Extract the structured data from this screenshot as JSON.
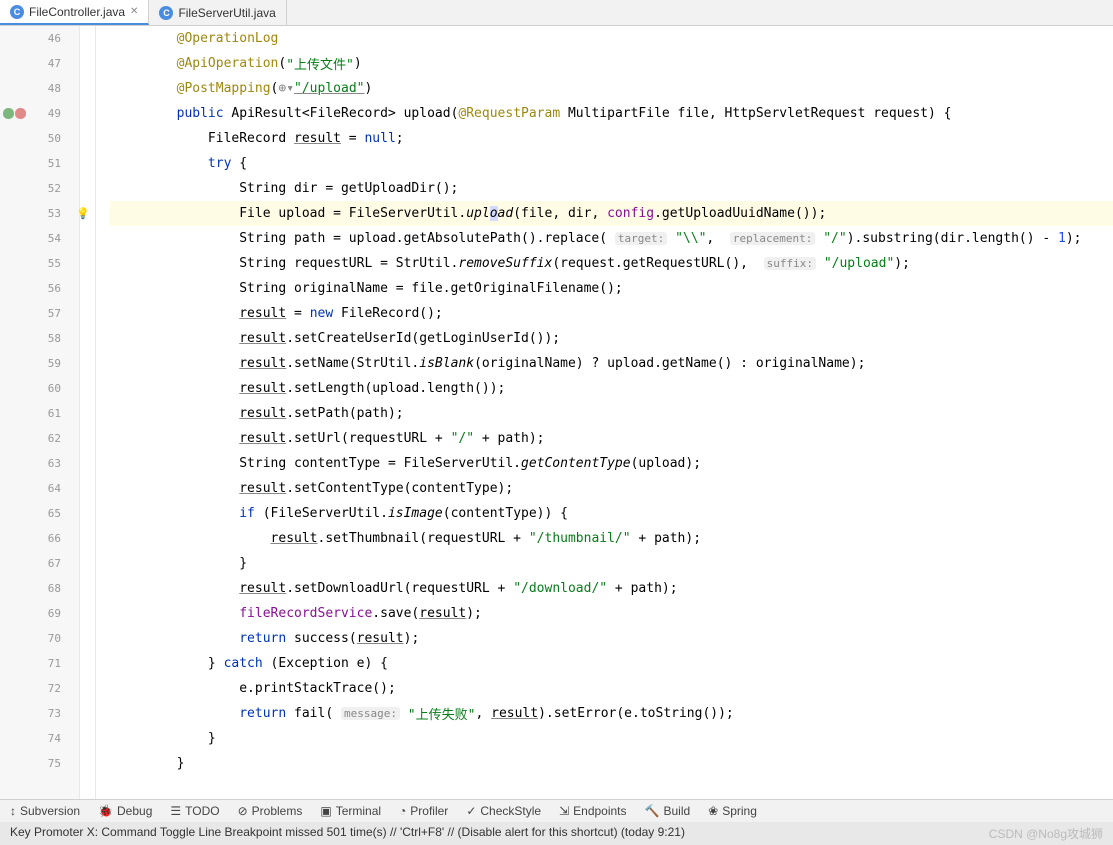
{
  "tabs": [
    {
      "name": "FileController.java",
      "active": true
    },
    {
      "name": "FileServerUtil.java",
      "active": false
    }
  ],
  "lines": [
    "46",
    "47",
    "48",
    "49",
    "50",
    "51",
    "52",
    "53",
    "54",
    "55",
    "56",
    "57",
    "58",
    "59",
    "60",
    "61",
    "62",
    "63",
    "64",
    "65",
    "66",
    "67",
    "68",
    "69",
    "70",
    "71",
    "72",
    "73",
    "74",
    "75"
  ],
  "code": {
    "l46": {
      "ind": "        ",
      "ann": "@OperationLog"
    },
    "l47": {
      "ind": "        ",
      "ann": "@ApiOperation",
      "p": "(",
      "s": "\"上传文件\"",
      "e": ")"
    },
    "l48": {
      "ind": "        ",
      "ann": "@PostMapping",
      "p": "(",
      "icon": "⊕▾",
      "s": "\"/upload\"",
      "e": ")"
    },
    "l49": {
      "ind": "        ",
      "kw1": "public",
      "t1": " ApiResult<FileRecord> upload(",
      "ann": "@RequestParam",
      "t2": " MultipartFile file, HttpServletRequest request) {"
    },
    "l50": {
      "ind": "            ",
      "t1": "FileRecord ",
      "u": "result",
      "t2": " = ",
      "kw": "null",
      "e": ";"
    },
    "l51": {
      "ind": "            ",
      "kw": "try",
      "e": " {"
    },
    "l52": {
      "ind": "                ",
      "t": "String dir = getUploadDir();"
    },
    "l53": {
      "ind": "                ",
      "t1": "File upload = FileServerUtil.",
      "m": "upl",
      "cr": "o",
      "m2": "ad",
      "t2": "(file, dir, ",
      "f": "config",
      "t3": ".getUploadUuidName());"
    },
    "l54": {
      "ind": "                ",
      "t1": "String path = upload.getAbsolutePath().replace( ",
      "h1": "target:",
      "s1": " \"\\\\\"",
      "t2": ",  ",
      "h2": "replacement:",
      "s2": " \"/\"",
      "t3": ").substring(dir.length() - ",
      "n": "1",
      "t4": ");"
    },
    "l55": {
      "ind": "                ",
      "t1": "String requestURL = StrUtil.",
      "m": "removeSuffix",
      "t2": "(request.getRequestURL(),  ",
      "h": "suffix:",
      "s": " \"/upload\"",
      "t3": ");"
    },
    "l56": {
      "ind": "                ",
      "t": "String originalName = file.getOriginalFilename();"
    },
    "l57": {
      "ind": "                ",
      "u": "result",
      "t1": " = ",
      "kw": "new",
      "t2": " FileRecord();"
    },
    "l58": {
      "ind": "                ",
      "u": "result",
      "t": ".setCreateUserId(getLoginUserId());"
    },
    "l59": {
      "ind": "                ",
      "u": "result",
      "t1": ".setName(StrUtil.",
      "m": "isBlank",
      "t2": "(originalName) ? upload.getName() : originalName);"
    },
    "l60": {
      "ind": "                ",
      "u": "result",
      "t": ".setLength(upload.length());"
    },
    "l61": {
      "ind": "                ",
      "u": "result",
      "t": ".setPath(path);"
    },
    "l62": {
      "ind": "                ",
      "u": "result",
      "t1": ".setUrl(requestURL + ",
      "s": "\"/\"",
      "t2": " + path);"
    },
    "l63": {
      "ind": "                ",
      "t1": "String contentType = FileServerUtil.",
      "m": "getContentType",
      "t2": "(upload);"
    },
    "l64": {
      "ind": "                ",
      "u": "result",
      "t": ".setContentType(contentType);"
    },
    "l65": {
      "ind": "                ",
      "kw": "if",
      "t1": " (FileServerUtil.",
      "m": "isImage",
      "t2": "(contentType)) {"
    },
    "l66": {
      "ind": "                    ",
      "u": "result",
      "t1": ".setThumbnail(requestURL + ",
      "s": "\"/thumbnail/\"",
      "t2": " + path);"
    },
    "l67": {
      "ind": "                ",
      "t": "}"
    },
    "l68": {
      "ind": "                ",
      "u": "result",
      "t1": ".setDownloadUrl(requestURL + ",
      "s": "\"/download/\"",
      "t2": " + path);"
    },
    "l69": {
      "ind": "                ",
      "f": "fileRecordService",
      "t1": ".save(",
      "u": "result",
      "t2": ");"
    },
    "l70": {
      "ind": "                ",
      "kw": "return",
      "t1": " success(",
      "u": "result",
      "t2": ");"
    },
    "l71": {
      "ind": "            ",
      "t1": "} ",
      "kw": "catch",
      "t2": " (Exception e) {"
    },
    "l72": {
      "ind": "                ",
      "t": "e.printStackTrace();"
    },
    "l73": {
      "ind": "                ",
      "kw": "return",
      "t1": " fail( ",
      "h": "message:",
      "s": " \"上传失败\"",
      "t2": ", ",
      "u": "result",
      "t3": ").setError(e.toString());"
    },
    "l74": {
      "ind": "            ",
      "t": "}"
    },
    "l75": {
      "ind": "        ",
      "t": "}"
    }
  },
  "tools": [
    {
      "i": "↕",
      "l": "Subversion"
    },
    {
      "i": "🐞",
      "l": "Debug"
    },
    {
      "i": "☰",
      "l": "TODO"
    },
    {
      "i": "⊘",
      "l": "Problems"
    },
    {
      "i": "▣",
      "l": "Terminal"
    },
    {
      "i": "◔",
      "l": "Profiler"
    },
    {
      "i": "✓",
      "l": "CheckStyle"
    },
    {
      "i": "⇲",
      "l": "Endpoints"
    },
    {
      "i": "🔨",
      "l": "Build"
    },
    {
      "i": "❀",
      "l": "Spring"
    }
  ],
  "status": "Key Promoter X: Command Toggle Line Breakpoint missed 501 time(s) // 'Ctrl+F8' // (Disable alert for this shortcut) (today 9:21)",
  "watermark": "CSDN @No8g攻城狮"
}
